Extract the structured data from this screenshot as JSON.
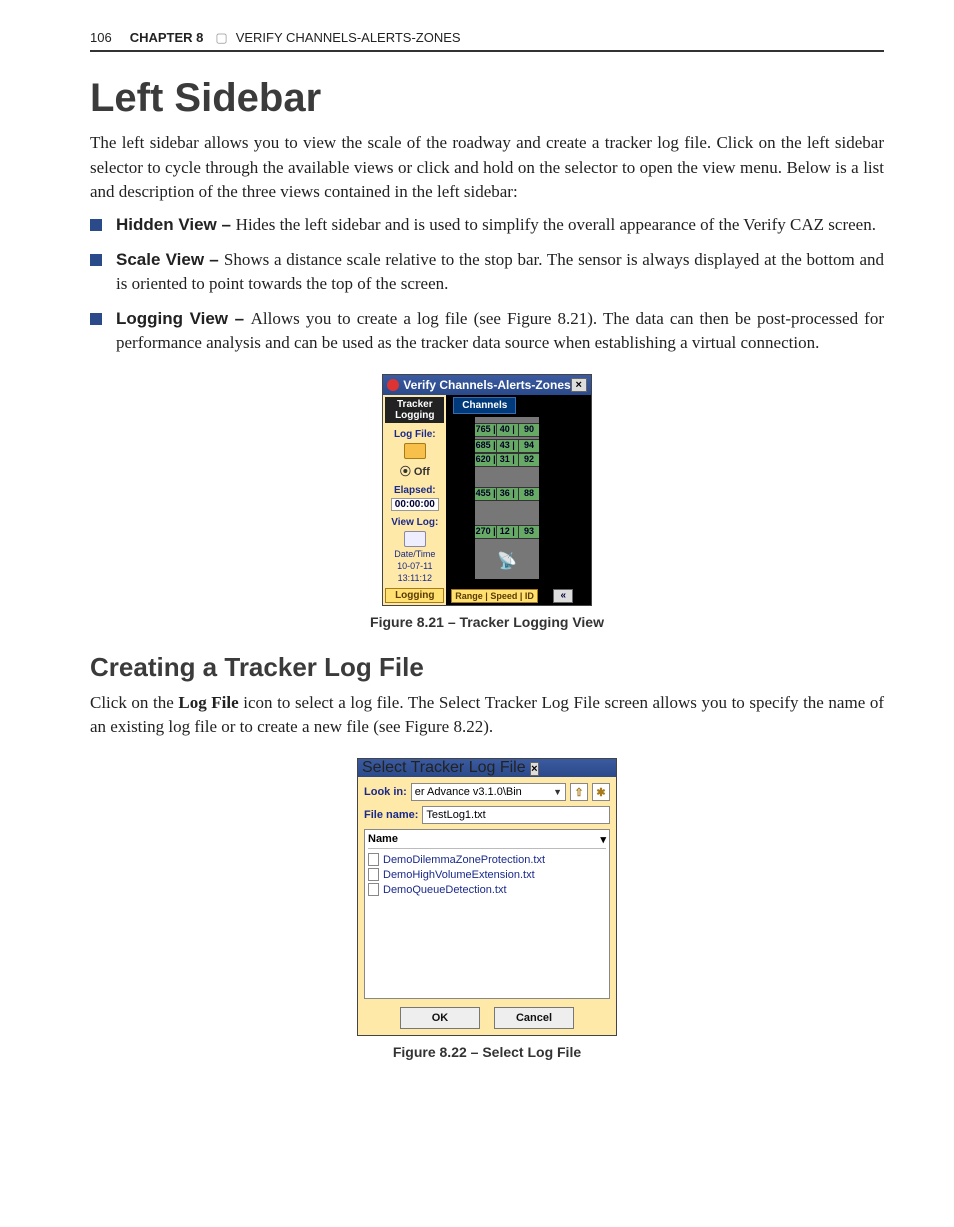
{
  "page_number": "106",
  "chapter_label": "CHAPTER 8",
  "chapter_title": "VERIFY CHANNELS-ALERTS-ZONES",
  "section_title": "Left Sidebar",
  "intro_paragraph": "The left sidebar allows you to view the scale of the roadway and create a tracker log file. Click on the left sidebar selector to cycle through the available views or click and hold on the selector to open the view menu. Below is a list and description of the three views contained in the left sidebar:",
  "bullets": [
    {
      "lead": "Hidden View – ",
      "text": "Hides the left sidebar and is used to simplify the overall appearance of the Verify CAZ screen."
    },
    {
      "lead": "Scale View – ",
      "text": "Shows a distance scale relative to the stop bar. The sensor is always displayed at the bottom and is oriented to point towards the top of the screen."
    },
    {
      "lead": "Logging View – ",
      "text": "Allows you to create a log file (see Figure 8.21). The data can then be post-processed for performance analysis and can be used as the tracker data source when establishing a virtual connection."
    }
  ],
  "fig1": {
    "window_title": "Verify Channels-Alerts-Zones",
    "side_tab": "Tracker\nLogging",
    "log_file_label": "Log File:",
    "off_label": "Off",
    "elapsed_label": "Elapsed:",
    "elapsed_value": "00:00:00",
    "view_log_label": "View Log:",
    "datetime_label": "Date/Time",
    "date_value": "10-07-11",
    "time_value": "13:11:12",
    "logging_tab": "Logging",
    "channels_tab": "Channels",
    "bottom_tabs": "Range | Speed | ID",
    "collapse": "«",
    "rows": [
      {
        "a": "765 |",
        "b": "40 |",
        "c": "90"
      },
      {
        "a": "685 |",
        "b": "43 |",
        "c": "94"
      },
      {
        "a": "620 |",
        "b": "31 |",
        "c": "92"
      },
      {
        "a": "455 |",
        "b": "36 |",
        "c": "88"
      },
      {
        "a": "270 |",
        "b": "12 |",
        "c": "93"
      }
    ],
    "caption": "Figure 8.21 – Tracker Logging View"
  },
  "subsection_title": "Creating a Tracker Log File",
  "subsection_para_prefix": "Click on the ",
  "subsection_para_bold": "Log File",
  "subsection_para_suffix": " icon to select a log file. The Select Tracker Log File screen allows you to specify the name of an existing log file or to create a new file (see Figure 8.22).",
  "fig2": {
    "window_title": "Select Tracker Log File",
    "lookin_label": "Look in:",
    "lookin_value": "er Advance v3.1.0\\Bin",
    "filename_label": "File name:",
    "filename_value": "TestLog1.txt",
    "name_header": "Name",
    "files": [
      "DemoDilemmaZoneProtection.txt",
      "DemoHighVolumeExtension.txt",
      "DemoQueueDetection.txt"
    ],
    "ok": "OK",
    "cancel": "Cancel",
    "caption": "Figure 8.22 – Select Log File"
  }
}
